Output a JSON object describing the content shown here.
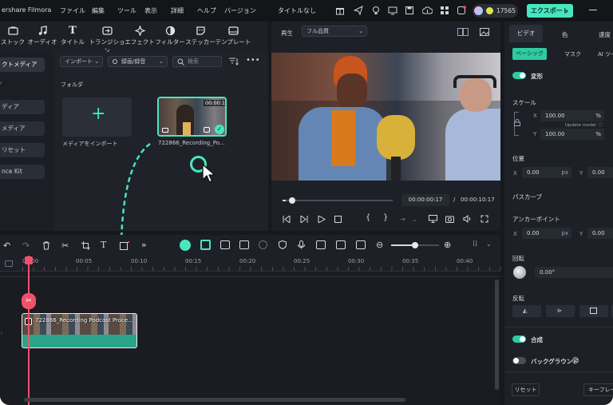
{
  "menubar": {
    "app_title": "ershare Filmora",
    "menus": [
      "ファイル",
      "編集",
      "ツール",
      "表示",
      "詳細",
      "ヘルプ",
      "バージョン"
    ],
    "doc_title": "タイトルなし",
    "credits": "17565",
    "export_label": "エクスポート"
  },
  "library": {
    "tabs": [
      "ストック",
      "オーディオ",
      "タイトル",
      "トランジション",
      "エフェクト",
      "フィルター",
      "ステッカー",
      "テンプレート"
    ],
    "side_items": [
      "クトメディア",
      "ディア",
      "メディア",
      "リセット",
      "nce Kit"
    ],
    "import_label": "インポート",
    "record_label": "録画/録音",
    "search_placeholder": "検索",
    "folder_label": "フォルダ",
    "import_media_label": "メディアをインポート",
    "clip_name": "722866_Recording_Po...",
    "clip_duration": "00:00:10"
  },
  "preview": {
    "play_label": "再生",
    "quality": "フル品質",
    "current_time": "00:00:00:17",
    "separator": "/",
    "total_time": "00:00:10:17",
    "progress": 0.03
  },
  "timeline": {
    "ruler": [
      "00:00",
      "00:05",
      "00:10",
      "00:15",
      "00:20",
      "00:25",
      "00:30",
      "00:35",
      "00:40"
    ],
    "clip_title": "722866_Recording Podcast Proce..."
  },
  "panel": {
    "tabs": [
      "ビデオ",
      "色",
      "速度"
    ],
    "subtabs": [
      "ベーシック",
      "マスク",
      "AI ツー"
    ],
    "transform": "変形",
    "scale": "スケール",
    "scale_x": "100.00",
    "scale_y": "100.00",
    "percent": "%",
    "update_model": "Update model",
    "position": "位置",
    "pos_x": "0.00",
    "pos_y": "0.00",
    "px": "px",
    "path_curve": "パスカーブ",
    "anchor": "アンカーポイント",
    "anchor_x": "0.00",
    "anchor_y": "0.00",
    "rotate": "回転",
    "rotate_value": "0.00°",
    "flip": "反転",
    "composite": "合成",
    "background": "バックグラウンド",
    "reset": "リセット",
    "keyframe": "キーフレー",
    "x_label": "X",
    "y_label": "Y"
  },
  "colors": {
    "accent": "#47e6c0",
    "playhead": "#f0516c",
    "clip": "#2aa58a"
  }
}
